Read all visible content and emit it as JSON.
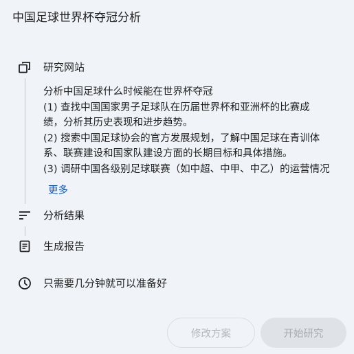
{
  "title": "中国足球世界杯夺冠分析",
  "steps": {
    "research": "研究网站",
    "analyze": "分析结果",
    "report": "生成报告"
  },
  "plan": {
    "heading": "分析中国足球什么时候能在世界杯夺冠",
    "line1": "(1) 查找中国国家男子足球队在历届世界杯和亚洲杯的比赛成",
    "line1b": "绩，分析其历史表现和进步趋势。",
    "line2": "(2) 搜索中国足球协会的官方发展规划，了解中国足球在青训体",
    "line2b": "系、联赛建设和国家队建设方面的长期目标和具体措施。",
    "line3": "(3) 调研中国各级别足球联赛（如中超、中甲、中乙）的运营情况"
  },
  "more_label": "更多",
  "time_note": "只需要几分钟就可以准备好",
  "buttons": {
    "edit": "修改方案",
    "start": "开始研究"
  },
  "icons": {
    "research": "browse-windows-icon",
    "analyze": "sort-lines-icon",
    "report": "document-icon",
    "time": "clock-icon"
  }
}
